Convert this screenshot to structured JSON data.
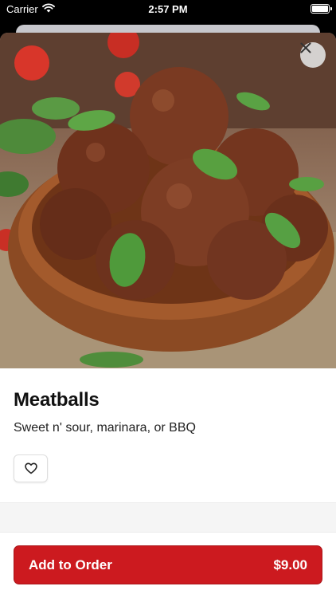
{
  "status_bar": {
    "carrier": "Carrier",
    "time": "2:57 PM"
  },
  "item": {
    "title": "Meatballs",
    "description": "Sweet n' sour, marinara, or BBQ"
  },
  "order_button": {
    "label": "Add to Order",
    "price": "$9.00"
  },
  "icons": {
    "close": "close-icon",
    "favorite": "heart-icon",
    "wifi": "wifi-icon",
    "battery": "battery-icon"
  },
  "colors": {
    "accent": "#cc1a1f"
  }
}
